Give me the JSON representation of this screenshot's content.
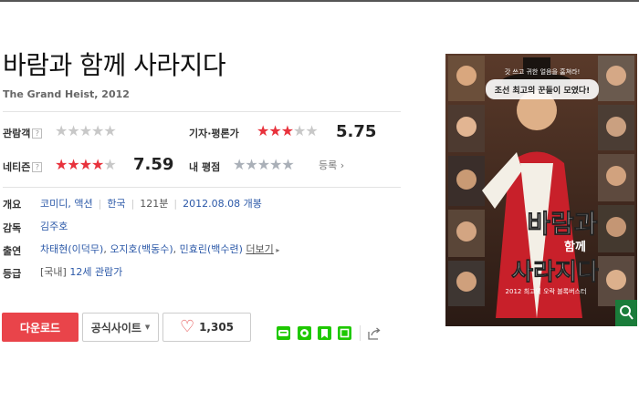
{
  "movie": {
    "title": "바람과 함께 사라지다",
    "subtitle": "The Grand Heist, 2012"
  },
  "ratings": {
    "audience": {
      "label": "관람객",
      "value": 0
    },
    "critic": {
      "label": "기자·평론가",
      "value": 5.75,
      "display": "5.75"
    },
    "netizen": {
      "label": "네티즌",
      "value": 7.59,
      "display": "7.59"
    },
    "my_rating": {
      "label": "내 평점",
      "value": 0,
      "register": "등록"
    }
  },
  "info": {
    "overview_label": "개요",
    "genre": "코미디, 액션",
    "country": "한국",
    "runtime": "121분",
    "release": "2012.08.08 개봉",
    "director_label": "감독",
    "director": "김주호",
    "cast_label": "출연",
    "cast": [
      "차태현(이덕무)",
      "오지호(백동수)",
      "민효린(백수련)"
    ],
    "more": "더보기",
    "grade_label": "등급",
    "grade_region": "[국내]",
    "grade": "12세 관람가"
  },
  "buttons": {
    "download": "다운로드",
    "official_site": "공식사이트",
    "like_count": "1,305"
  },
  "colors": {
    "star_on": "#e8323c",
    "star_off": "#c8c8c8",
    "accent_red": "#e9444a",
    "link_blue": "#2c59a8",
    "naver_green": "#1ec800"
  },
  "poster": {
    "tagline_1": "갓 쓰고 귀한 얼음을 훔쳐라!",
    "tagline_2": "조선 최고의 꾼들이 모였다!",
    "title_1": "바람과",
    "title_2": "함께",
    "title_3": "사라지다",
    "bottom": "2012 최고의 오락 블록버스터"
  }
}
